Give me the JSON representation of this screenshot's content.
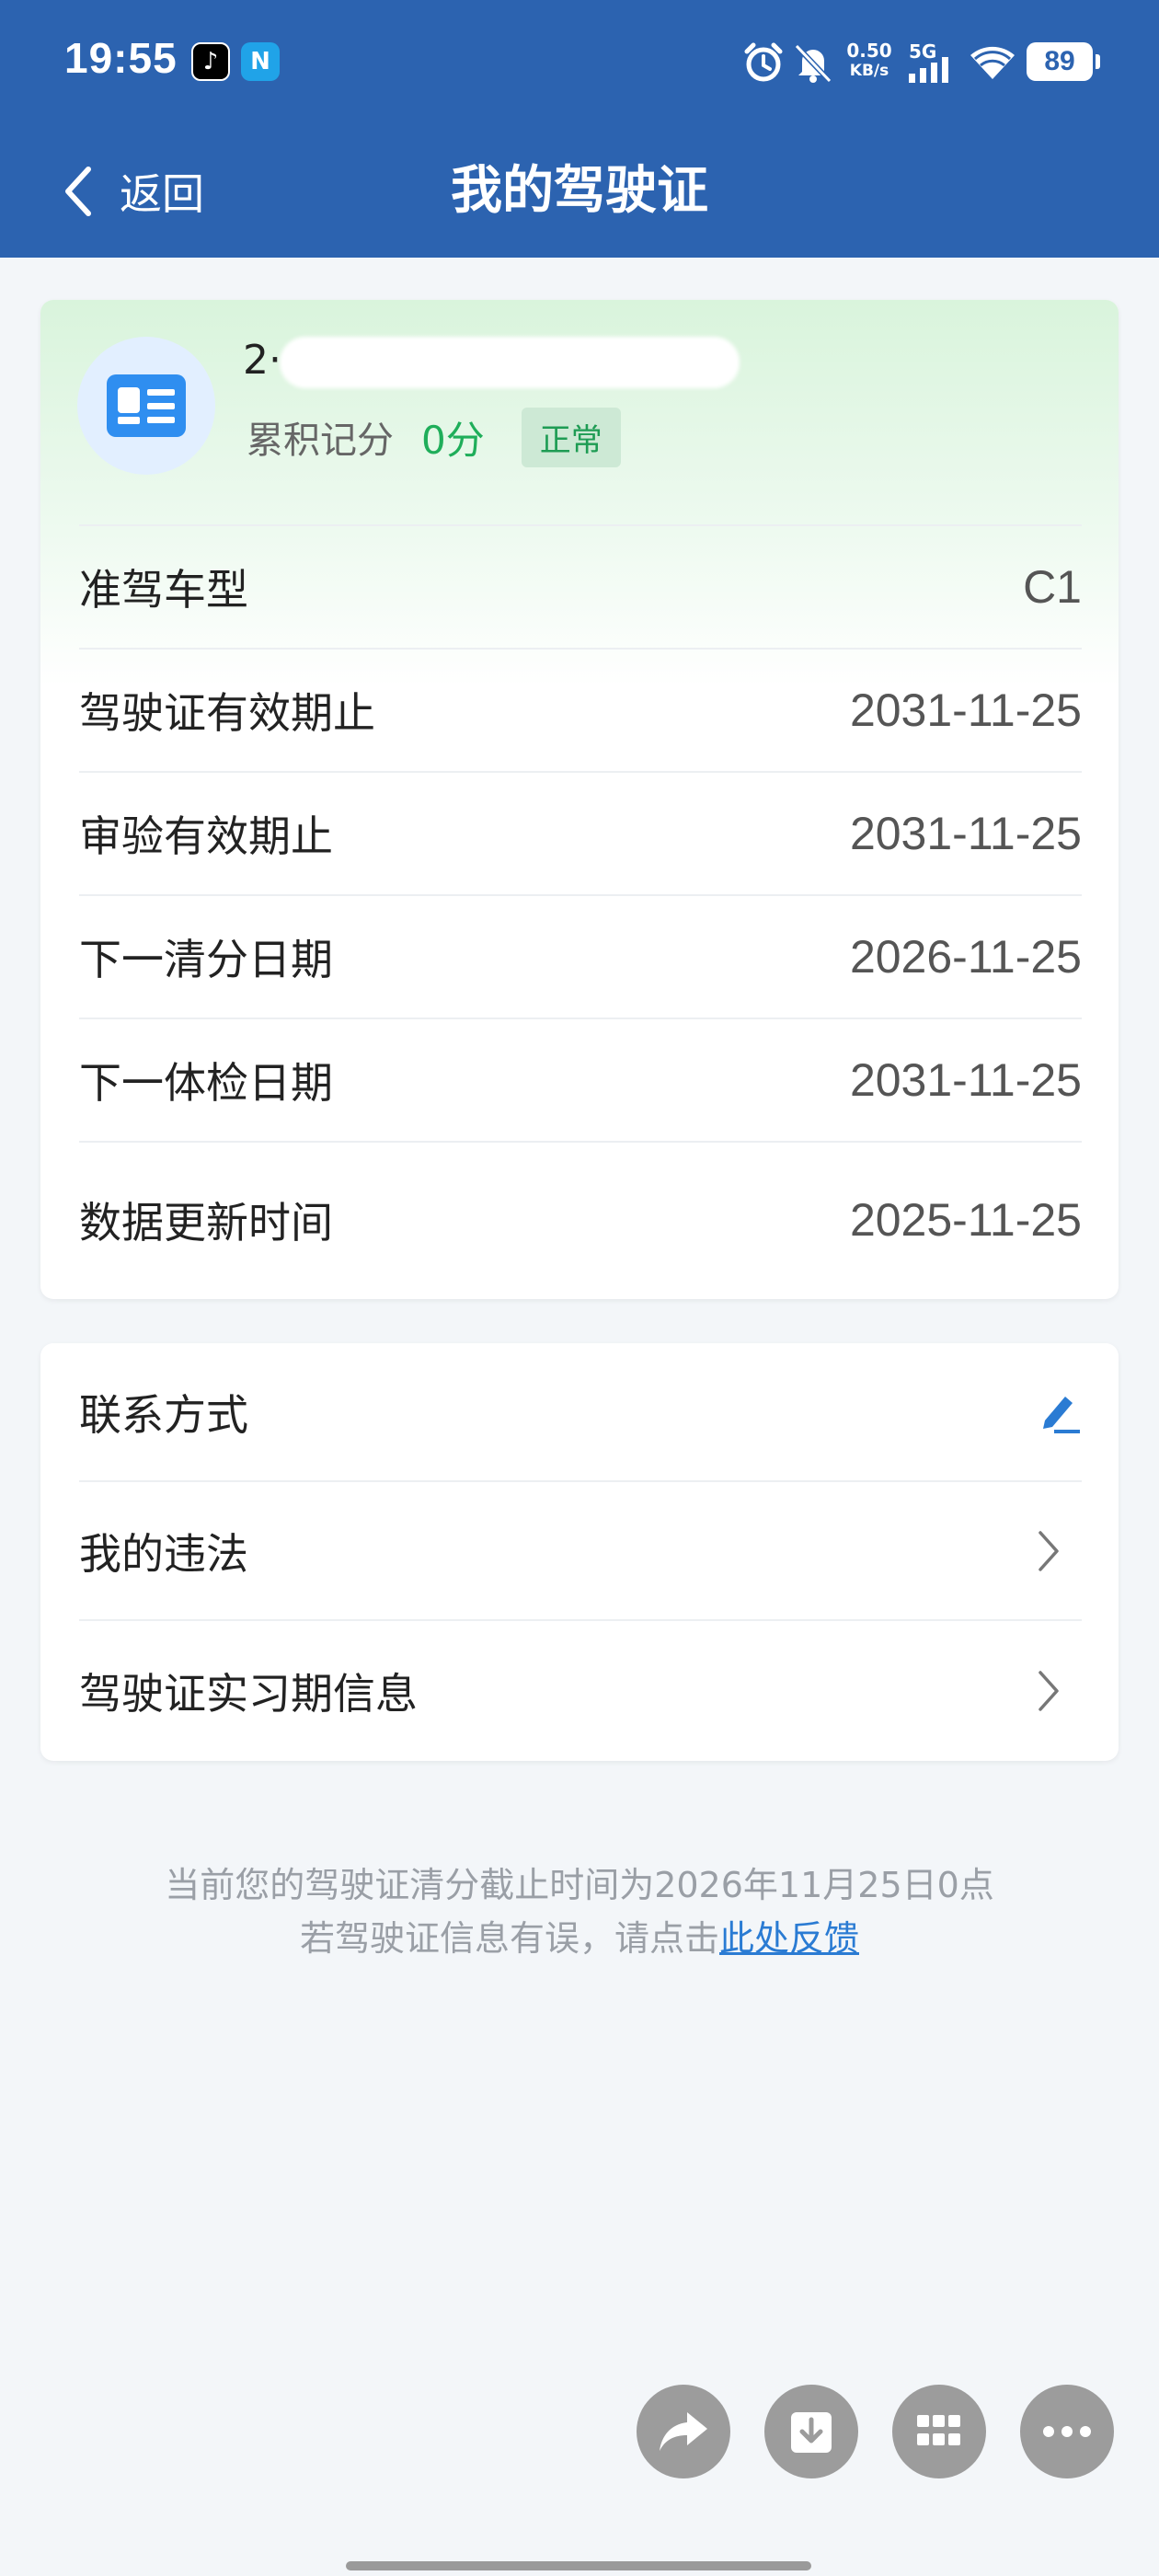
{
  "status_bar": {
    "time": "19:55",
    "net_speed_value": "0.50",
    "net_speed_unit": "KB/s",
    "network_type": "5G",
    "battery": "89",
    "icons": [
      "tiktok-icon",
      "nfc-icon",
      "alarm-icon",
      "mute-icon",
      "signal-icon",
      "wifi-icon",
      "battery-icon"
    ]
  },
  "nav": {
    "back_label": "返回",
    "title": "我的驾驶证"
  },
  "license": {
    "name_partial": "2··· ··· 1310",
    "points_label": "累积记分",
    "points_value": "0分",
    "status": "正常",
    "rows": [
      {
        "label": "准驾车型",
        "value": "C1"
      },
      {
        "label": "驾驶证有效期止",
        "value": "2031-11-25"
      },
      {
        "label": "审验有效期止",
        "value": "2031-11-25"
      },
      {
        "label": "下一清分日期",
        "value": "2026-11-25"
      },
      {
        "label": "下一体检日期",
        "value": "2031-11-25"
      },
      {
        "label": "数据更新时间",
        "value": "2025-11-25"
      }
    ]
  },
  "links": [
    {
      "label": "联系方式",
      "icon": "edit-icon"
    },
    {
      "label": "我的违法",
      "icon": "chevron-right-icon"
    },
    {
      "label": "驾驶证实习期信息",
      "icon": "chevron-right-icon"
    }
  ],
  "notice": {
    "line1": "当前您的驾驶证清分截止时间为2026年11月25日0点",
    "line2_prefix": "若驾驶证信息有误，请点击",
    "line2_link": "此处反馈"
  },
  "fabs": [
    "share-icon",
    "download-icon",
    "apps-grid-icon",
    "more-icon"
  ],
  "colors": {
    "header": "#2c63b0",
    "accent_green": "#1fae5a",
    "link_blue": "#2a7bd3"
  }
}
